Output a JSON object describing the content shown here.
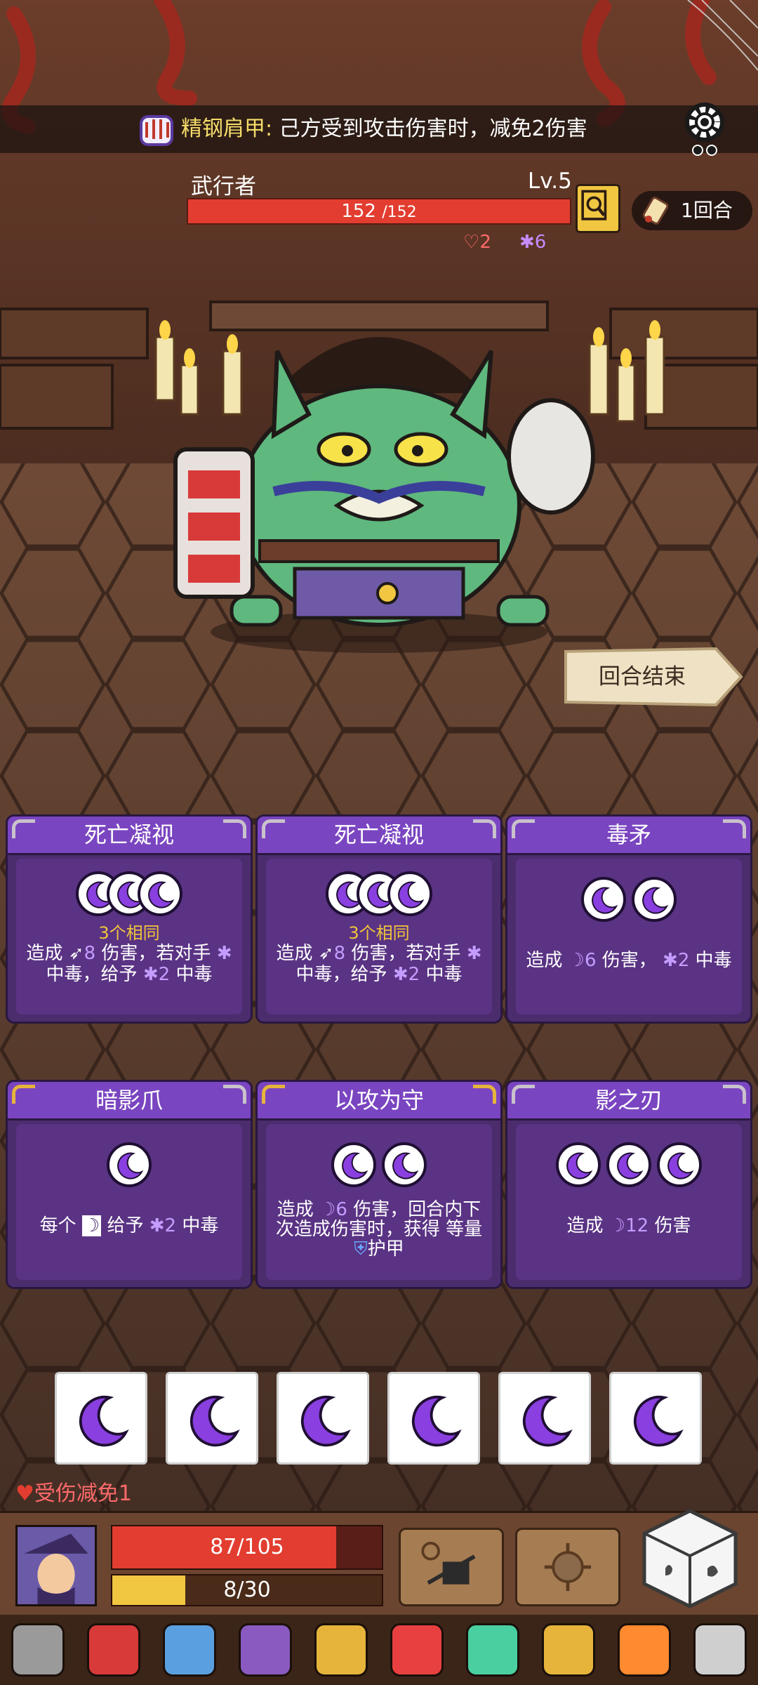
{
  "banner": {
    "title": "精钢肩甲:",
    "desc": "己方受到攻击伤害时，减免2伤害",
    "icon": "steel-pauldron-icon"
  },
  "enemy": {
    "name": "武行者",
    "level": "Lv.5",
    "hp": "152",
    "hp_max": "/152",
    "hp_fraction": 1.0,
    "shield": "2",
    "poison": "6"
  },
  "round": {
    "label": "1回合"
  },
  "end_turn": {
    "label": "回合结束"
  },
  "cards": [
    {
      "title": "死亡凝视",
      "slots": 3,
      "overlap": true,
      "same": "3个相同",
      "line1_a": "造成",
      "line1_num": "8",
      "line1_b": "伤害，若对手",
      "line2_a": "中毒，给予",
      "line2_num": "2",
      "line2_b": "中毒"
    },
    {
      "title": "死亡凝视",
      "slots": 3,
      "overlap": true,
      "same": "3个相同",
      "line1_a": "造成",
      "line1_num": "8",
      "line1_b": "伤害，若对手",
      "line2_a": "中毒，给予",
      "line2_num": "2",
      "line2_b": "中毒"
    },
    {
      "title": "毒矛",
      "slots": 2,
      "overlap": false,
      "line1_a": "造成",
      "line1_num": "6",
      "line1_b": "伤害，",
      "line1_num2": "2",
      "line1_c": "中毒"
    },
    {
      "title": "暗影爪",
      "slots": 1,
      "overlap": false,
      "line1_a": "每个",
      "line1_b": "给予",
      "line1_num": "2",
      "line1_c": "中毒"
    },
    {
      "title": "以攻为守",
      "slots": 2,
      "overlap": false,
      "line1_a": "造成",
      "line1_num": "6",
      "line1_b": "伤害，回合内下",
      "line2": "次造成伤害时，获得 等量",
      "line3": "护甲"
    },
    {
      "title": "影之刃",
      "slots": 3,
      "overlap": false,
      "line1_a": "造成",
      "line1_num": "12",
      "line1_b": "伤害"
    }
  ],
  "dice_count": 6,
  "status": {
    "damage_reduce": "受伤减免1"
  },
  "player": {
    "hp": "87/105",
    "hp_fraction": 0.83,
    "shield": "8/30",
    "shield_fraction": 0.27
  },
  "colors": {
    "card_purple": "#4b2d6e",
    "card_header": "#7a45c0",
    "moon": "#8a3fe0",
    "hp_red": "#e23d30",
    "gold": "#f1c641"
  },
  "relics": [
    "knight-helmet-icon",
    "fire-dragon-icon",
    "ice-sword-icon",
    "purple-gauntlet-icon",
    "golden-shield-icon",
    "heart-shield-icon",
    "green-d20-icon",
    "amulet-icon",
    "fire-gem-icon",
    "scroll-icon"
  ]
}
